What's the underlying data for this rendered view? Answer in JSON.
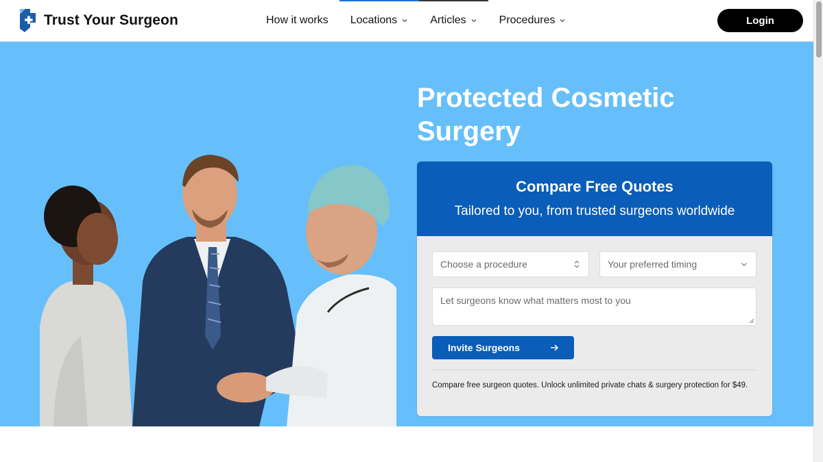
{
  "brand": {
    "name": "Trust Your Surgeon",
    "logo_icon": "medical-cross-icon",
    "accent": "#1a5ea8"
  },
  "nav": {
    "items": [
      {
        "label": "How it works",
        "has_dropdown": false
      },
      {
        "label": "Locations",
        "has_dropdown": true
      },
      {
        "label": "Articles",
        "has_dropdown": true
      },
      {
        "label": "Procedures",
        "has_dropdown": true
      }
    ],
    "login_label": "Login"
  },
  "hero": {
    "title": "Protected Cosmetic Surgery",
    "background": "#66bffb",
    "image_subject": "patient, suited advisor and surgeon shaking hands"
  },
  "quote_card": {
    "title": "Compare Free Quotes",
    "subtitle": "Tailored to you, from trusted surgeons worldwide",
    "header_color": "#0a5db8",
    "procedure_placeholder": "Choose a procedure",
    "timing_placeholder": "Your preferred timing",
    "notes_placeholder": "Let surgeons know what matters most to you",
    "invite_label": "Invite Surgeons",
    "footnote": "Compare free surgeon quotes. Unlock unlimited private chats & surgery protection for $49."
  }
}
